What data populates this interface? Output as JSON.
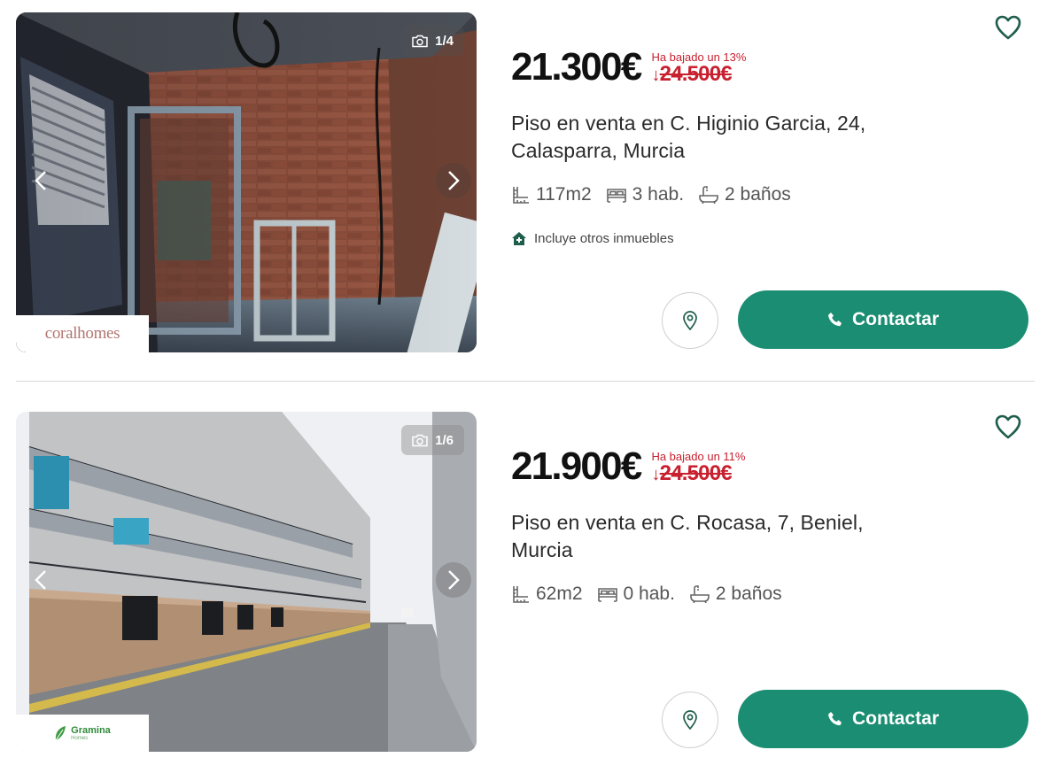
{
  "listings": [
    {
      "photo_counter": "1/4",
      "price": "21.300€",
      "price_drop_label": "Ha bajado un 13%",
      "old_price": "24.500€",
      "title": "Piso en venta en C. Higinio Garcia, 24, Calasparra, Murcia",
      "size": "117m2",
      "rooms": "3 hab.",
      "bathrooms": "2 baños",
      "includes_label": "Incluye otros inmuebles",
      "contact_label": "Contactar",
      "agency_logo": "coralhomes"
    },
    {
      "photo_counter": "1/6",
      "price": "21.900€",
      "price_drop_label": "Ha bajado un 11%",
      "old_price": "24.500€",
      "title": "Piso en venta en C. Rocasa, 7, Beniel, Murcia",
      "size": "62m2",
      "rooms": "0 hab.",
      "bathrooms": "2 baños",
      "contact_label": "Contactar",
      "agency_logo": "Gramina",
      "agency_logo_sub": "Homes"
    }
  ],
  "colors": {
    "accent": "#1a8d72",
    "price_drop": "#c8202f",
    "heart": "#1f5e4d"
  },
  "icons": {
    "favorite": "heart-icon",
    "camera": "camera-icon",
    "size": "floorplan-icon",
    "rooms": "bed-icon",
    "bathrooms": "bathtub-icon",
    "includes": "house-plus-icon",
    "map": "map-pin-icon",
    "phone": "phone-icon",
    "prev": "chevron-left-icon",
    "next": "chevron-right-icon"
  }
}
